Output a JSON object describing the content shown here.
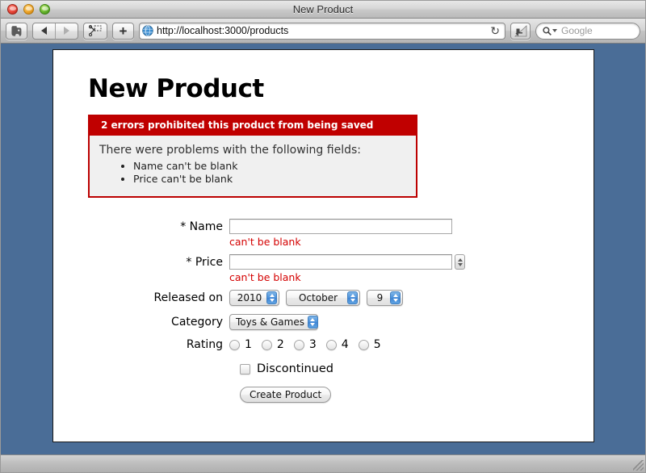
{
  "window": {
    "title": "New Product",
    "traffic_lights": [
      "close",
      "minimize",
      "zoom"
    ]
  },
  "toolbar": {
    "evernote_label": "",
    "back_label": "",
    "forward_label": "",
    "clip_label": "",
    "add_label": "+",
    "url": "http://localhost:3000/products",
    "reload_glyph": "↻",
    "search_glyph": "⚲",
    "search_placeholder": "Google"
  },
  "page": {
    "title": "New Product",
    "error": {
      "heading": "2 errors prohibited this product from being saved",
      "intro": "There were problems with the following fields:",
      "items": [
        "Name can't be blank",
        "Price can't be blank"
      ],
      "accent_color": "#c00000",
      "border_color": "#bc0000",
      "body_bg": "#f0f0f0"
    },
    "form": {
      "name": {
        "label": "* Name",
        "value": "",
        "error": "can't be blank"
      },
      "price": {
        "label": "* Price",
        "value": "",
        "error": "can't be blank"
      },
      "released_on": {
        "label": "Released on",
        "year": "2010",
        "month": "October",
        "day": "9"
      },
      "category": {
        "label": "Category",
        "value": "Toys & Games"
      },
      "rating": {
        "label": "Rating",
        "options": [
          "1",
          "2",
          "3",
          "4",
          "5"
        ],
        "selected": null
      },
      "discontinued": {
        "label": "Discontinued",
        "checked": false
      },
      "submit_label": "Create Product",
      "error_color": "#d40000"
    }
  }
}
